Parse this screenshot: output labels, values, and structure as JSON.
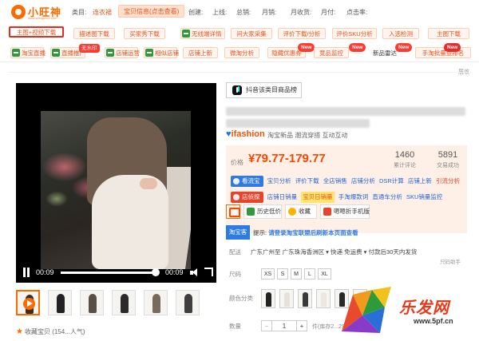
{
  "toolbar": {
    "logo_text": "小旺神",
    "logo_sub": "www.wangshen.com",
    "category_label": "类目:",
    "category_value": "连衣裙",
    "info_badge": "宝贝信息(点击查看)",
    "created_label": "创建:",
    "listed_label": "上线:",
    "total_sales_label": "总销:",
    "monthly_sales_label": "月销:",
    "monthly_revenue_label": "月收货:",
    "monthly_pay_label": "月付:",
    "clicks_label": "点击率:",
    "row2": [
      "主图+视频下载",
      "描述图下载",
      "买家秀下载",
      "无线端详情",
      "问大家采集",
      "评价下载/分析",
      "评价SKU分析",
      "入选检测",
      "主图下载"
    ],
    "row3": [
      "淘宝直播",
      "直播推广",
      "无水印",
      "店铺运营",
      "相似店铺",
      "店铺上新",
      "微淘分析",
      "隐藏优惠券",
      "竞品监控",
      "新品雷达",
      "手淘批量查排名"
    ],
    "free_badge": "无水印",
    "new_badge": "New",
    "collapse_label": "展收"
  },
  "video": {
    "current_time": "00:09",
    "duration": "00:09",
    "progress": 1.0
  },
  "favorite": {
    "icon": "star-icon",
    "label": "收藏宝贝 (154...人气)"
  },
  "product": {
    "store_button": "抖音该类目商品榜",
    "brand": "ifashion",
    "brand_tags": "淘宝新品 潮流穿搭 互动互动",
    "price_label": "价格",
    "price": "¥79.77-179.77",
    "stats": [
      {
        "value": "1460",
        "label": "累计评论"
      },
      {
        "value": "5891",
        "label": "交易成功"
      }
    ],
    "line1_tag": "看流宝",
    "line1_links": [
      "宝贝分析",
      "评价下载",
      "全店销售",
      "店铺分析",
      "DSR计算",
      "店铺上新",
      "引流分析"
    ],
    "line2_tag": "店侦探",
    "line2_links": [
      "店铺日销量",
      "宝贝日销量",
      "手淘爆款词",
      "直通车分析",
      "SKU销量监控"
    ],
    "tools": [
      "历史低价",
      "收藏",
      "嗯嗯折手机版"
    ],
    "taobao_button": "淘宝客",
    "taobao_hint_prefix": "提示:",
    "taobao_hint": "请登录淘宝联盟后刷新本页面查看",
    "delivery_label": "配送",
    "delivery_text": "广东广州至  广东珠海香洲区 ▾  快递 免运费 ▾  付款后30天内发货",
    "delivery_sub": "只码助手",
    "size_label": "尺码",
    "sizes": [
      "XS",
      "S",
      "M",
      "L",
      "XL"
    ],
    "color_label": "颜色分类",
    "qty_label": "数量",
    "qty_minus": "−",
    "qty_value": "1",
    "qty_plus": "+",
    "stock": "件(库存2...29)"
  },
  "watermark": {
    "text": "乐发网",
    "url": "www.5pf.cn"
  },
  "colors": {
    "accent": "#ff6a00",
    "price": "#ff4400",
    "link": "#2765d8"
  }
}
